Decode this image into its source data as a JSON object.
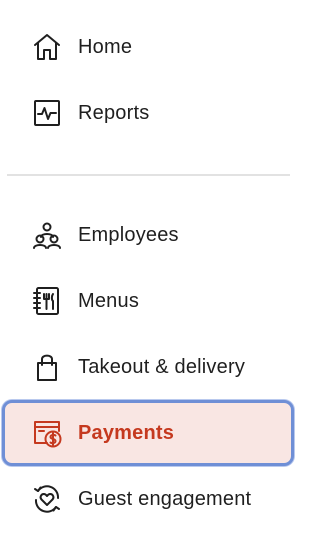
{
  "sidebar": {
    "items": [
      {
        "label": "Home",
        "icon": "home-icon",
        "active": false
      },
      {
        "label": "Reports",
        "icon": "reports-icon",
        "active": false
      },
      {
        "label": "Employees",
        "icon": "employees-icon",
        "active": false
      },
      {
        "label": "Menus",
        "icon": "menus-icon",
        "active": false
      },
      {
        "label": "Takeout & delivery",
        "icon": "shopping-bag-icon",
        "active": false
      },
      {
        "label": "Payments",
        "icon": "payments-icon",
        "active": true
      },
      {
        "label": "Guest engagement",
        "icon": "guest-engagement-icon",
        "active": false
      }
    ]
  },
  "colors": {
    "active_text": "#c5391f",
    "active_background": "#f9e6e3",
    "focus_ring": "#6f8fd6",
    "text": "#1f1f1f",
    "divider": "#e2e2e2"
  }
}
